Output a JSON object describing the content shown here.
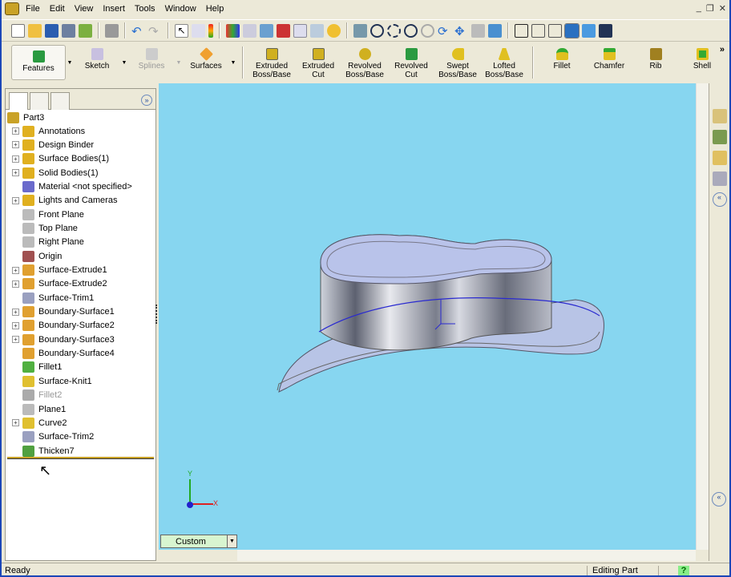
{
  "menu": [
    "File",
    "Edit",
    "View",
    "Insert",
    "Tools",
    "Window",
    "Help"
  ],
  "command_manager": {
    "tabs": [
      "Features",
      "Sketch",
      "Splines",
      "Surfaces"
    ],
    "buttons": [
      [
        "Extruded",
        "Boss/Base"
      ],
      [
        "Extruded",
        "Cut"
      ],
      [
        "Revolved",
        "Boss/Base"
      ],
      [
        "Revolved",
        "Cut"
      ],
      [
        "Swept",
        "Boss/Base"
      ],
      [
        "Lofted",
        "Boss/Base"
      ],
      [
        "Fillet",
        ""
      ],
      [
        "Chamfer",
        ""
      ],
      [
        "Rib",
        ""
      ],
      [
        "Shell",
        ""
      ]
    ]
  },
  "tree": {
    "root": "Part3",
    "items": [
      {
        "label": "Annotations",
        "exp": true,
        "color": "#e0b020"
      },
      {
        "label": "Design Binder",
        "exp": true,
        "color": "#e0b020"
      },
      {
        "label": "Surface Bodies(1)",
        "exp": true,
        "color": "#e0b020"
      },
      {
        "label": "Solid Bodies(1)",
        "exp": true,
        "color": "#e0b020"
      },
      {
        "label": "Material <not specified>",
        "exp": false,
        "color": "#6a6acc"
      },
      {
        "label": "Lights and Cameras",
        "exp": true,
        "color": "#e0b020"
      },
      {
        "label": "Front Plane",
        "exp": false,
        "color": "#bbbbbb"
      },
      {
        "label": "Top Plane",
        "exp": false,
        "color": "#bbbbbb"
      },
      {
        "label": "Right Plane",
        "exp": false,
        "color": "#bbbbbb"
      },
      {
        "label": "Origin",
        "exp": false,
        "color": "#a05050"
      },
      {
        "label": "Surface-Extrude1",
        "exp": true,
        "color": "#e0a030"
      },
      {
        "label": "Surface-Extrude2",
        "exp": true,
        "color": "#e0a030"
      },
      {
        "label": "Surface-Trim1",
        "exp": false,
        "color": "#9aa0c0"
      },
      {
        "label": "Boundary-Surface1",
        "exp": true,
        "color": "#e0a030"
      },
      {
        "label": "Boundary-Surface2",
        "exp": true,
        "color": "#e0a030"
      },
      {
        "label": "Boundary-Surface3",
        "exp": true,
        "color": "#e0a030"
      },
      {
        "label": "Boundary-Surface4",
        "exp": false,
        "color": "#e0a030"
      },
      {
        "label": "Fillet1",
        "exp": false,
        "color": "#50b040"
      },
      {
        "label": "Surface-Knit1",
        "exp": false,
        "color": "#e0c030"
      },
      {
        "label": "Fillet2",
        "exp": false,
        "color": "#aaaaaa",
        "dim": true
      },
      {
        "label": "Plane1",
        "exp": false,
        "color": "#bbbbbb"
      },
      {
        "label": "Curve2",
        "exp": true,
        "color": "#e0c030"
      },
      {
        "label": "Surface-Trim2",
        "exp": false,
        "color": "#9aa0c0"
      },
      {
        "label": "Thicken7",
        "exp": false,
        "color": "#50a040"
      }
    ]
  },
  "view": {
    "orientation": "Custom",
    "axis_x": "X",
    "axis_y": "Y"
  },
  "status": {
    "left": "Ready",
    "mode": "Editing Part",
    "help": "?"
  }
}
